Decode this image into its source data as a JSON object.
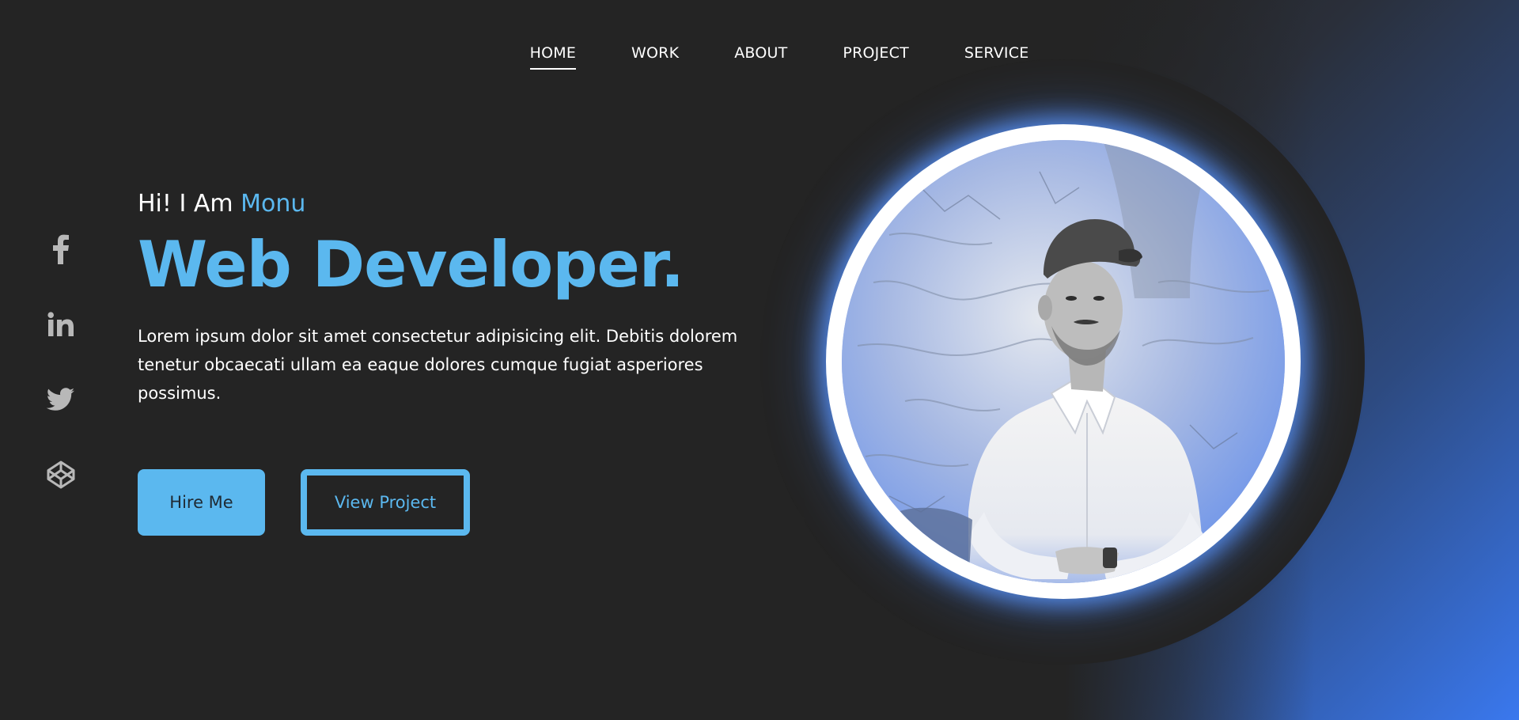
{
  "nav": {
    "items": [
      {
        "label": "HOME",
        "active": true
      },
      {
        "label": "WORK",
        "active": false
      },
      {
        "label": "ABOUT",
        "active": false
      },
      {
        "label": "PROJECT",
        "active": false
      },
      {
        "label": "SERVICE",
        "active": false
      }
    ]
  },
  "social": {
    "icons": [
      "facebook-icon",
      "linkedin-icon",
      "twitter-icon",
      "codepen-icon"
    ]
  },
  "hero": {
    "greeting_prefix": "Hi! I Am ",
    "greeting_name": "Monu",
    "headline": "Web Developer.",
    "description": "Lorem ipsum dolor sit amet consectetur adipisicing elit. Debitis dolorem tenetur obcaecati ullam ea eaque dolores cumque fugiat asperiores possimus."
  },
  "buttons": {
    "hire_label": "Hire Me",
    "view_label": "View Project"
  },
  "colors": {
    "background": "#242424",
    "accent": "#5bb8ef",
    "gradient_end": "#3a78ee"
  }
}
